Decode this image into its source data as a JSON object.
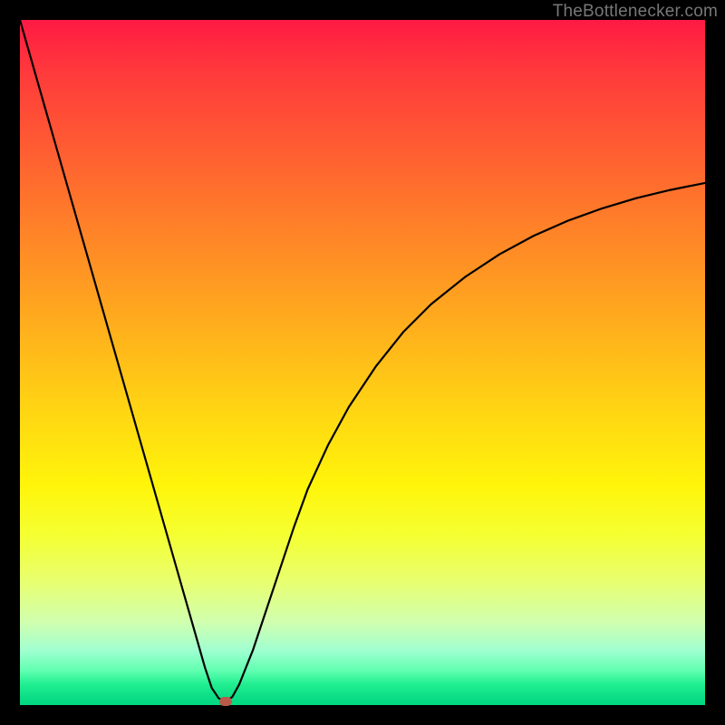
{
  "watermark": "TheBottlenecker.com",
  "chart_data": {
    "type": "line",
    "title": "",
    "xlabel": "",
    "ylabel": "",
    "xlim": [
      0,
      100
    ],
    "ylim": [
      0,
      100
    ],
    "x": [
      0,
      2,
      4,
      6,
      8,
      10,
      12,
      14,
      16,
      18,
      20,
      22,
      24,
      26,
      27,
      28,
      29,
      30,
      31,
      32,
      34,
      36,
      38,
      40,
      42,
      45,
      48,
      52,
      56,
      60,
      65,
      70,
      75,
      80,
      85,
      90,
      95,
      100
    ],
    "values": [
      100,
      93,
      86,
      79,
      72,
      65,
      58,
      51,
      44,
      37,
      30,
      23,
      16,
      9,
      5.5,
      2.5,
      1,
      0.5,
      1.2,
      3,
      8,
      14,
      20,
      26,
      31.5,
      38,
      43.5,
      49.5,
      54.5,
      58.5,
      62.5,
      65.8,
      68.5,
      70.7,
      72.5,
      74,
      75.2,
      76.2
    ],
    "marker": {
      "x": 30,
      "y": 0.5
    },
    "gradient": {
      "top_color": "#ff1a44",
      "bottom_color": "#00d880"
    }
  }
}
